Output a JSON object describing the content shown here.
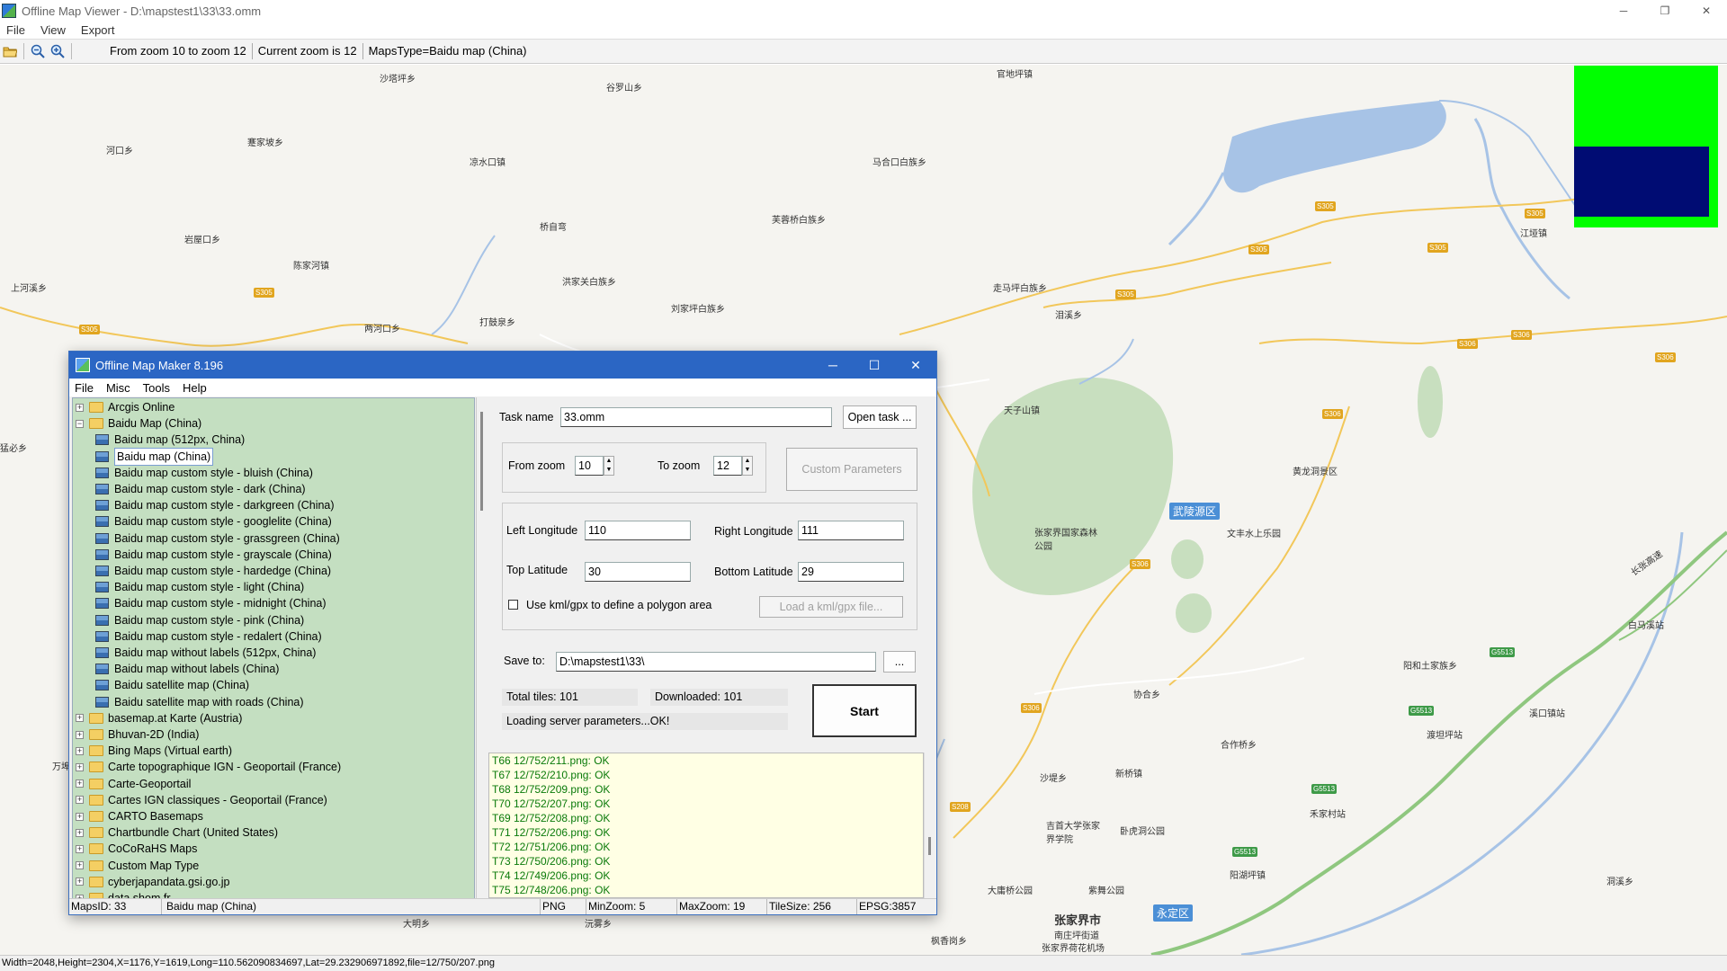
{
  "window": {
    "title": "Offline Map Viewer - D:\\mapstest1\\33\\33.omm",
    "controls": [
      "─",
      "❐",
      "✕"
    ]
  },
  "menu": [
    "File",
    "View",
    "Export"
  ],
  "toolbar": {
    "zoom_range": "From zoom 10 to zoom 12",
    "current_zoom": "Current zoom is 12",
    "maps_type": "MapsType=Baidu map (China)"
  },
  "map": {
    "places": [
      {
        "name": "沙塔坪乡",
        "id": "p1"
      },
      {
        "name": "谷罗山乡",
        "id": "p2"
      },
      {
        "name": "官地坪镇",
        "id": "p3"
      },
      {
        "name": "河口乡",
        "id": "p4"
      },
      {
        "name": "蹇家坡乡",
        "id": "p5"
      },
      {
        "name": "凉水口镇",
        "id": "p6"
      },
      {
        "name": "马合口白族乡",
        "id": "p7"
      },
      {
        "name": "岩屋口乡",
        "id": "p8"
      },
      {
        "name": "桥自弯",
        "id": "p9"
      },
      {
        "name": "芙蓉桥白族乡",
        "id": "p10"
      },
      {
        "name": "江垭镇",
        "id": "p11"
      },
      {
        "name": "陈家河镇",
        "id": "p12"
      },
      {
        "name": "洪家关白族乡",
        "id": "p13"
      },
      {
        "name": "上河溪乡",
        "id": "p14"
      },
      {
        "name": "刘家坪白族乡",
        "id": "p15"
      },
      {
        "name": "走马坪白族乡",
        "id": "p16"
      },
      {
        "name": "两河口乡",
        "id": "p17"
      },
      {
        "name": "打鼓泉乡",
        "id": "p18"
      },
      {
        "name": "泪溪乡",
        "id": "p19"
      },
      {
        "name": "天子山镇",
        "id": "p20"
      },
      {
        "name": "黄龙洞景区",
        "id": "p21"
      },
      {
        "name": "张家界国家森林公园",
        "id": "p22"
      },
      {
        "name": "文丰水上乐园",
        "id": "p23"
      },
      {
        "name": "白马溪站",
        "id": "p24"
      },
      {
        "name": "阳和土家族乡",
        "id": "p25"
      },
      {
        "name": "协合乡",
        "id": "p26"
      },
      {
        "name": "溪口镇站",
        "id": "p27"
      },
      {
        "name": "合作桥乡",
        "id": "p28"
      },
      {
        "name": "渡坦坪站",
        "id": "p29"
      },
      {
        "name": "沙堤乡",
        "id": "p30"
      },
      {
        "name": "新桥镇",
        "id": "p31"
      },
      {
        "name": "禾家村站",
        "id": "p32"
      },
      {
        "name": "吉首大学张家界学院",
        "id": "p33"
      },
      {
        "name": "卧虎洞公园",
        "id": "p34"
      },
      {
        "name": "阳湖坪镇",
        "id": "p35"
      },
      {
        "name": "大庸桥公园",
        "id": "p36"
      },
      {
        "name": "紫舞公园",
        "id": "p37"
      },
      {
        "name": "洞溪乡",
        "id": "p38"
      },
      {
        "name": "张家界市",
        "id": "p39"
      },
      {
        "name": "南庄坪街道",
        "id": "p40"
      },
      {
        "name": "枫香岗乡",
        "id": "p41"
      },
      {
        "name": "张家界荷花机场",
        "id": "p42"
      },
      {
        "name": "大明乡",
        "id": "p43"
      },
      {
        "name": "沅雾乡",
        "id": "p44"
      },
      {
        "name": "万埠",
        "id": "p45"
      },
      {
        "name": "猛必乡",
        "id": "p46"
      }
    ],
    "district_tags": [
      "武陵源区",
      "永定区"
    ],
    "road_badges": [
      "S305",
      "S305",
      "S305",
      "S305",
      "S305",
      "S305",
      "S305",
      "S306",
      "S306",
      "S306",
      "S306",
      "S306",
      "S306",
      "S208"
    ],
    "highway_badges": [
      "G5513",
      "G5513",
      "G5513",
      "G5513"
    ],
    "expressway_label": "长张高速"
  },
  "statusbar": "Width=2048,Height=2304,X=1176,Y=1619,Long=110.562090834697,Lat=29.232906971892,file=12/750/207.png",
  "dialog": {
    "title": "Offline Map Maker 8.196",
    "menu": [
      "File",
      "Misc",
      "Tools",
      "Help"
    ],
    "tree": [
      {
        "label": "Arcgis Online",
        "level": 0,
        "type": "folder",
        "exp": "+"
      },
      {
        "label": "Baidu Map (China)",
        "level": 0,
        "type": "folder",
        "exp": "−"
      },
      {
        "label": "Baidu map (512px, China)",
        "level": 1,
        "type": "map"
      },
      {
        "label": "Baidu map (China)",
        "level": 1,
        "type": "map",
        "selected": true
      },
      {
        "label": "Baidu map custom style - bluish (China)",
        "level": 1,
        "type": "map"
      },
      {
        "label": "Baidu map custom style - dark (China)",
        "level": 1,
        "type": "map"
      },
      {
        "label": "Baidu map custom style - darkgreen (China)",
        "level": 1,
        "type": "map"
      },
      {
        "label": "Baidu map custom style - googlelite (China)",
        "level": 1,
        "type": "map"
      },
      {
        "label": "Baidu map custom style - grassgreen (China)",
        "level": 1,
        "type": "map"
      },
      {
        "label": "Baidu map custom style - grayscale (China)",
        "level": 1,
        "type": "map"
      },
      {
        "label": "Baidu map custom style - hardedge (China)",
        "level": 1,
        "type": "map"
      },
      {
        "label": "Baidu map custom style - light (China)",
        "level": 1,
        "type": "map"
      },
      {
        "label": "Baidu map custom style - midnight (China)",
        "level": 1,
        "type": "map"
      },
      {
        "label": "Baidu map custom style - pink (China)",
        "level": 1,
        "type": "map"
      },
      {
        "label": "Baidu map custom style - redalert (China)",
        "level": 1,
        "type": "map"
      },
      {
        "label": "Baidu map without labels (512px, China)",
        "level": 1,
        "type": "map"
      },
      {
        "label": "Baidu map without labels (China)",
        "level": 1,
        "type": "map"
      },
      {
        "label": "Baidu satellite map (China)",
        "level": 1,
        "type": "map"
      },
      {
        "label": "Baidu satellite map with roads (China)",
        "level": 1,
        "type": "map"
      },
      {
        "label": "basemap.at Karte (Austria)",
        "level": 0,
        "type": "folder",
        "exp": "+"
      },
      {
        "label": "Bhuvan-2D (India)",
        "level": 0,
        "type": "folder",
        "exp": "+"
      },
      {
        "label": "Bing Maps (Virtual earth)",
        "level": 0,
        "type": "folder",
        "exp": "+"
      },
      {
        "label": "Carte topographique IGN - Geoportail (France)",
        "level": 0,
        "type": "folder",
        "exp": "+"
      },
      {
        "label": "Carte-Geoportail",
        "level": 0,
        "type": "folder",
        "exp": "+"
      },
      {
        "label": "Cartes IGN classiques - Geoportail (France)",
        "level": 0,
        "type": "folder",
        "exp": "+"
      },
      {
        "label": "CARTO Basemaps",
        "level": 0,
        "type": "folder",
        "exp": "+"
      },
      {
        "label": "Chartbundle Chart (United States)",
        "level": 0,
        "type": "folder",
        "exp": "+"
      },
      {
        "label": "CoCoRaHS Maps",
        "level": 0,
        "type": "folder",
        "exp": "+"
      },
      {
        "label": "Custom Map Type",
        "level": 0,
        "type": "folder",
        "exp": "+"
      },
      {
        "label": "cyberjapandata.gsi.go.jp",
        "level": 0,
        "type": "folder",
        "exp": "+"
      },
      {
        "label": "data.shom.fr",
        "level": 0,
        "type": "folder",
        "exp": "+"
      }
    ],
    "task_name_label": "Task name",
    "task_name_value": "33.omm",
    "open_task_button": "Open task ...",
    "from_zoom_label": "From zoom",
    "from_zoom_value": "10",
    "to_zoom_label": "To zoom",
    "to_zoom_value": "12",
    "custom_params_button": "Custom Parameters",
    "left_lon_label": "Left Longitude",
    "left_lon_value": "110",
    "right_lon_label": "Right Longitude",
    "right_lon_value": "111",
    "top_lat_label": "Top Latitude",
    "top_lat_value": "30",
    "bottom_lat_label": "Bottom Latitude",
    "bottom_lat_value": "29",
    "kml_checkbox_label": "Use kml/gpx to define a polygon area",
    "load_kml_button": "Load a kml/gpx file...",
    "save_to_label": "Save to:",
    "save_to_value": "D:\\mapstest1\\33\\",
    "browse_button": "...",
    "total_tiles": "Total tiles: 101",
    "downloaded": "Downloaded: 101",
    "loading_status": "Loading server parameters...OK!",
    "start_button": "Start",
    "log": [
      "T66 12/752/211.png: OK",
      "T67 12/752/210.png: OK",
      "T68 12/752/209.png: OK",
      "T70 12/752/207.png: OK",
      "T69 12/752/208.png: OK",
      "T71 12/752/206.png: OK",
      "T72 12/751/206.png: OK",
      "T73 12/750/206.png: OK",
      "T74 12/749/206.png: OK",
      "T75 12/748/206.png: OK"
    ],
    "status": {
      "maps_id": "MapsID: 33",
      "map_name": "Baidu map (China)",
      "format": "PNG",
      "min_zoom": "MinZoom: 5",
      "max_zoom": "MaxZoom: 19",
      "tile_size": "TileSize: 256",
      "epsg": "EPSG:3857"
    }
  }
}
